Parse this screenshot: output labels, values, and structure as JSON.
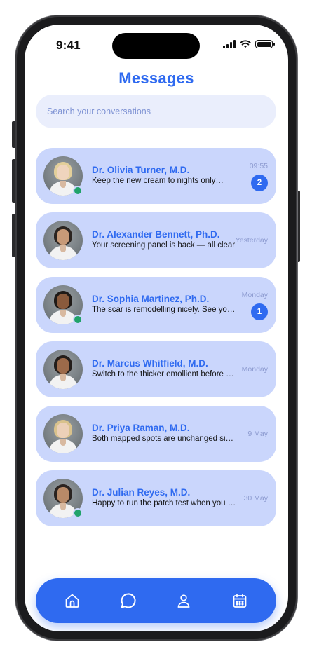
{
  "status_bar": {
    "time": "9:41"
  },
  "header": {
    "title": "Messages"
  },
  "search": {
    "placeholder": "Search your conversations"
  },
  "colors": {
    "accent": "#2f6af0",
    "card": "#cad6fc",
    "online": "#21a36a"
  },
  "conversations": [
    {
      "name": "Dr. Olivia Turner, M.D.",
      "preview": "Keep the new cream to nights only…",
      "time": "09:55",
      "unread": "2",
      "online": true
    },
    {
      "name": "Dr. Alexander Bennett, Ph.D.",
      "preview": "Your screening panel is back — all clear",
      "time": "Yesterday",
      "unread": "",
      "online": false
    },
    {
      "name": "Dr. Sophia Martinez, Ph.D.",
      "preview": "The scar is remodelling nicely. See you soon",
      "time": "Monday",
      "unread": "1",
      "online": true
    },
    {
      "name": "Dr. Marcus Whitfield, M.D.",
      "preview": "Switch to the thicker emollient before bed",
      "time": "Monday",
      "unread": "",
      "online": false
    },
    {
      "name": "Dr. Priya Raman, M.D.",
      "preview": "Both mapped spots are unchanged since last visit",
      "time": "9 May",
      "unread": "",
      "online": false
    },
    {
      "name": "Dr. Julian Reyes, M.D.",
      "preview": "Happy to run the patch test when you are ready",
      "time": "30 May",
      "unread": "",
      "online": true
    }
  ],
  "tabbar": {
    "items": [
      {
        "icon": "home-icon",
        "label": "Home"
      },
      {
        "icon": "chat-bubble-icon",
        "label": "Messages"
      },
      {
        "icon": "person-icon",
        "label": "Profile"
      },
      {
        "icon": "calendar-icon",
        "label": "Calendar"
      }
    ]
  }
}
